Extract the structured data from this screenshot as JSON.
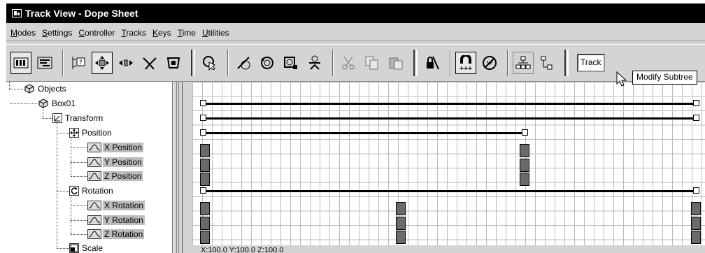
{
  "window": {
    "title": "Track View - Dope Sheet"
  },
  "menu": [
    {
      "pre": "",
      "u": "M",
      "post": "odes"
    },
    {
      "pre": "",
      "u": "S",
      "post": "ettings"
    },
    {
      "pre": "",
      "u": "C",
      "post": "ontroller"
    },
    {
      "pre": "",
      "u": "T",
      "post": "racks"
    },
    {
      "pre": "",
      "u": "K",
      "post": "eys"
    },
    {
      "pre": "",
      "u": "T",
      "post": "ime"
    },
    {
      "pre": "",
      "u": "U",
      "post": "tilities"
    }
  ],
  "toolbar": {
    "track_field": "Track",
    "tooltip": "Modify Subtree",
    "icons": [
      "edit-keys-icon",
      "edit-ranges-icon",
      "filters-icon",
      "move-keys-icon",
      "slide-keys-icon",
      "scale-keys-icon",
      "scale-time-icon",
      "select-time-icon",
      "delete-time-icon",
      "reverse-time-icon",
      "insert-time-icon",
      "scale-values-icon",
      "cut-icon",
      "copy-icon",
      "paste-icon",
      "lock-selection-icon",
      "snap-frames-icon",
      "show-keyable-icon",
      "modify-subtree-icon",
      "modify-child-keys-icon"
    ]
  },
  "tree": {
    "items": [
      {
        "label": "Objects",
        "icon": "objects-icon",
        "highlight": false
      },
      {
        "label": "Box01",
        "icon": "box-object-icon",
        "highlight": false
      },
      {
        "label": "Transform",
        "icon": "transform-icon",
        "highlight": false
      },
      {
        "label": "Position",
        "icon": "position-icon",
        "highlight": false
      },
      {
        "label": "X Position",
        "icon": "curve-icon",
        "highlight": true
      },
      {
        "label": "Y Position",
        "icon": "curve-icon",
        "highlight": true
      },
      {
        "label": "Z Position",
        "icon": "curve-icon",
        "highlight": true
      },
      {
        "label": "Rotation",
        "icon": "rotation-icon",
        "highlight": false
      },
      {
        "label": "X Rotation",
        "icon": "curve-icon",
        "highlight": true
      },
      {
        "label": "Y Rotation",
        "icon": "curve-icon",
        "highlight": true
      },
      {
        "label": "Z Rotation",
        "icon": "curve-icon",
        "highlight": true
      },
      {
        "label": "Scale",
        "icon": "scale-icon",
        "highlight": false
      }
    ]
  },
  "status": {
    "coords": "X:100.0 Y:100.0 Z:100.0"
  }
}
